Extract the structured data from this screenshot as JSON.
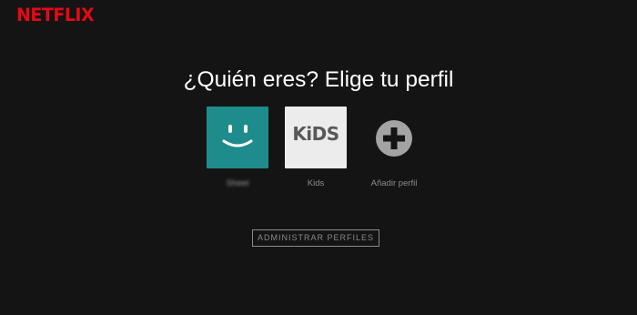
{
  "brand": {
    "logo_text": "NETFLIX",
    "color": "#e50914"
  },
  "page": {
    "title": "¿Quién eres? Elige tu perfil",
    "background": "#141414"
  },
  "profiles": [
    {
      "name": "Sheet",
      "avatar": "smiley-face-icon",
      "tile_color": "#1e8c8c",
      "name_blurred": true
    },
    {
      "name": "Kids",
      "avatar": "kids-logo",
      "tile_color": "#ececec",
      "logo_text": "KiDS"
    },
    {
      "name": "Añadir perfil",
      "avatar": "plus-circle-icon",
      "tile_color": "#a3a3a3"
    }
  ],
  "manage_button": {
    "label": "ADMINISTRAR PERFILES"
  }
}
